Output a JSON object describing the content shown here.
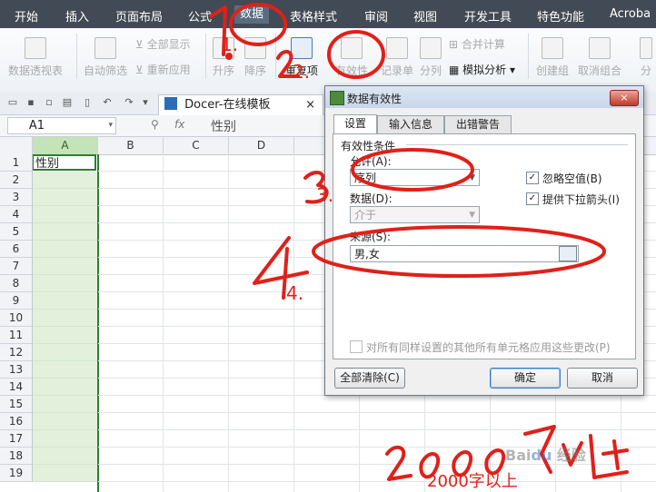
{
  "menu": {
    "items": [
      "开始",
      "插入",
      "页面布局",
      "公式",
      "数据",
      "表格样式",
      "审阅",
      "视图",
      "开发工具",
      "特色功能",
      "Acroba"
    ],
    "active_index": 4
  },
  "ribbon": {
    "pivot_table": "数据透视表",
    "auto_filter": "自动筛选",
    "show_all": "全部显示",
    "reapply": "重新应用",
    "sort_asc": "升序",
    "sort_desc": "降序",
    "duplicates": "重复项",
    "validity": "有效性",
    "record_form": "记录单",
    "text_to_columns": "分列",
    "consolidate": "合并计算",
    "what_if": "模拟分析",
    "group": "创建组",
    "ungroup": "取消组合",
    "cut_off": "分"
  },
  "doc_tab": {
    "title": "Docer-在线模板",
    "close": "×"
  },
  "formula_bar": {
    "cell_ref": "A1",
    "fx": "fx",
    "content": "性别"
  },
  "sheet": {
    "columns": [
      "A",
      "B",
      "C",
      "D"
    ],
    "rows": [
      "1",
      "2",
      "3",
      "4",
      "5",
      "6",
      "7",
      "8",
      "9",
      "10",
      "11",
      "12",
      "13",
      "14",
      "15",
      "16",
      "17",
      "18",
      "19"
    ],
    "a1_value": "性别"
  },
  "dialog": {
    "title": "数据有效性",
    "close": "×",
    "tabs": [
      "设置",
      "输入信息",
      "出错警告"
    ],
    "section_label": "有效性条件",
    "allow_label": "允许(A):",
    "allow_value": "序列",
    "ignore_blank": "忽略空值(B)",
    "dropdown": "提供下拉箭头(I)",
    "data_label": "数据(D):",
    "data_value": "介于",
    "source_label": "来源(S):",
    "source_value": "男,女",
    "apply_all": "对所有同样设置的其他所有单元格应用这些更改(P)",
    "clear_all": "全部清除(C)",
    "ok": "确定",
    "cancel": "取消"
  },
  "annotations": {
    "step1": "1.",
    "step2": "2.",
    "step3": "3.",
    "step4": "4.",
    "note": "2000字以上"
  },
  "colors": {
    "menu_bg": "#424a55",
    "selected_column": "#e3f1dc",
    "annotation_red": "#e0201a",
    "dialog_title": "#c7d6e9"
  }
}
